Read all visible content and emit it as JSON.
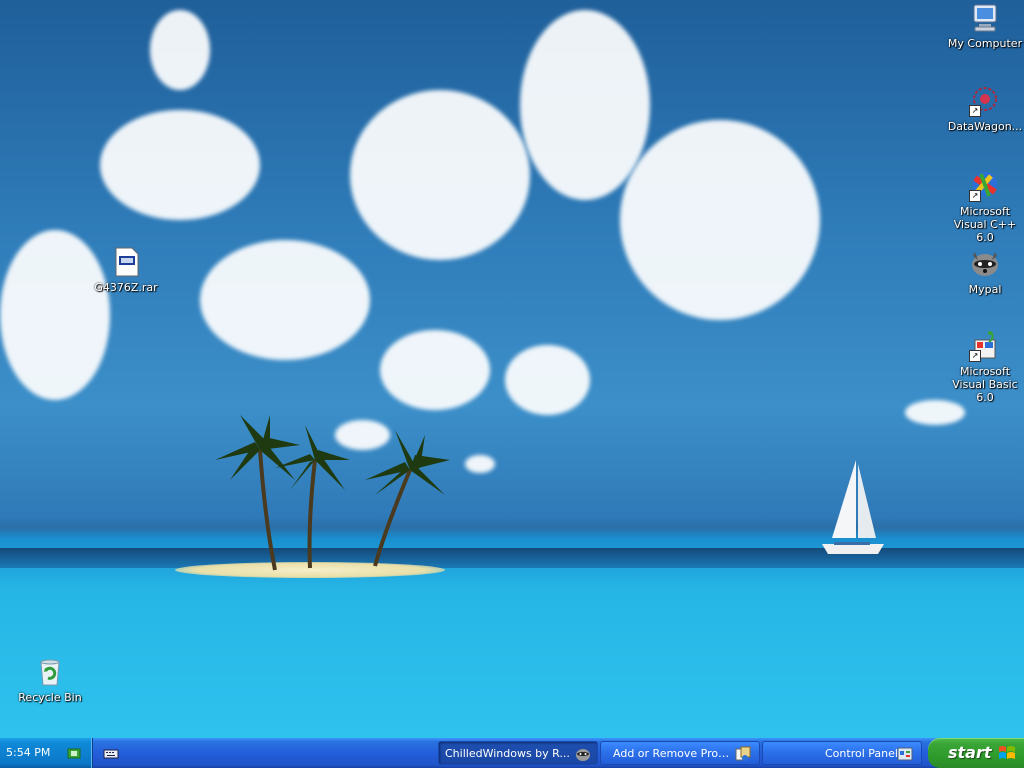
{
  "desktop": {
    "icons": [
      {
        "name": "my-computer",
        "label": "My Computer"
      },
      {
        "name": "datawagon",
        "label": "DataWagon..."
      },
      {
        "name": "msvc",
        "label": "Microsoft Visual C++ 6.0"
      },
      {
        "name": "mypal",
        "label": "Mypal"
      },
      {
        "name": "msvb",
        "label": "Microsoft Visual Basic 6.0"
      },
      {
        "name": "rar-file",
        "label": "G4376Z.rar"
      },
      {
        "name": "recycle-bin",
        "label": "Recycle Bin"
      }
    ]
  },
  "taskbar": {
    "start_label": "start",
    "clock": "5:54 PM",
    "buttons": [
      {
        "label": "Control Panel",
        "active": false
      },
      {
        "label": "Add or Remove Progr...",
        "active": false
      },
      {
        "label": "ChilledWindows by R...",
        "active": true
      }
    ]
  },
  "colors": {
    "taskbar_blue": "#245edb",
    "start_green": "#3aa537",
    "tray_blue": "#0c77c8"
  }
}
